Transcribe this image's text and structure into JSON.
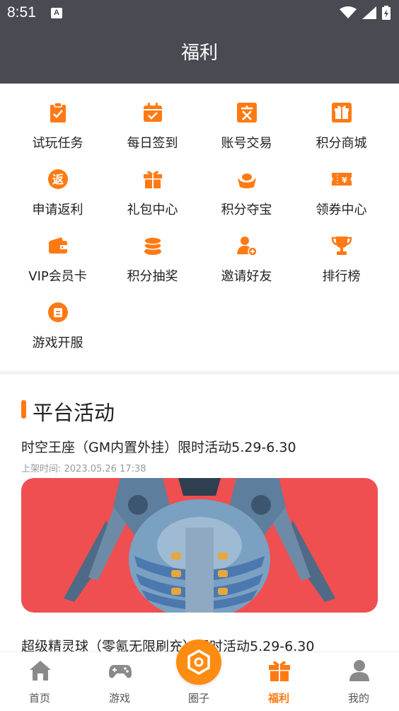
{
  "status_bar": {
    "time": "8:51",
    "notification_icon": "A"
  },
  "app_bar": {
    "title": "福利"
  },
  "menu": [
    {
      "label": "试玩任务",
      "icon": "clipboard-check-icon"
    },
    {
      "label": "每日签到",
      "icon": "calendar-check-icon"
    },
    {
      "label": "账号交易",
      "icon": "exchange-icon"
    },
    {
      "label": "积分商城",
      "icon": "gift-box-icon"
    },
    {
      "label": "申请返利",
      "icon": "rebate-icon"
    },
    {
      "label": "礼包中心",
      "icon": "gift-icon"
    },
    {
      "label": "积分夺宝",
      "icon": "treasure-icon"
    },
    {
      "label": "领券中心",
      "icon": "coupon-icon"
    },
    {
      "label": "VIP会员卡",
      "icon": "wallet-icon"
    },
    {
      "label": "积分抽奖",
      "icon": "coins-stack-icon"
    },
    {
      "label": "邀请好友",
      "icon": "add-user-icon"
    },
    {
      "label": "排行榜",
      "icon": "trophy-icon"
    },
    {
      "label": "游戏开服",
      "icon": "server-icon"
    }
  ],
  "section": {
    "title": "平台活动"
  },
  "activities": [
    {
      "title": "时空王座（GM内置外挂）限时活动5.29-6.30",
      "time": "上架时间: 2023.05.26 17:38"
    },
    {
      "title": "超级精灵球（零氪无限刷充）限时活动5.29-6.30"
    }
  ],
  "tabs": [
    {
      "label": "首页",
      "icon": "home-icon"
    },
    {
      "label": "游戏",
      "icon": "gamepad-icon"
    },
    {
      "label": "圈子",
      "icon": "hexagon-icon"
    },
    {
      "label": "福利",
      "icon": "gift-icon"
    },
    {
      "label": "我的",
      "icon": "user-icon"
    }
  ],
  "colors": {
    "accent": "#ff7a14",
    "header": "#4a4a53",
    "banner": "#ef4f50"
  }
}
